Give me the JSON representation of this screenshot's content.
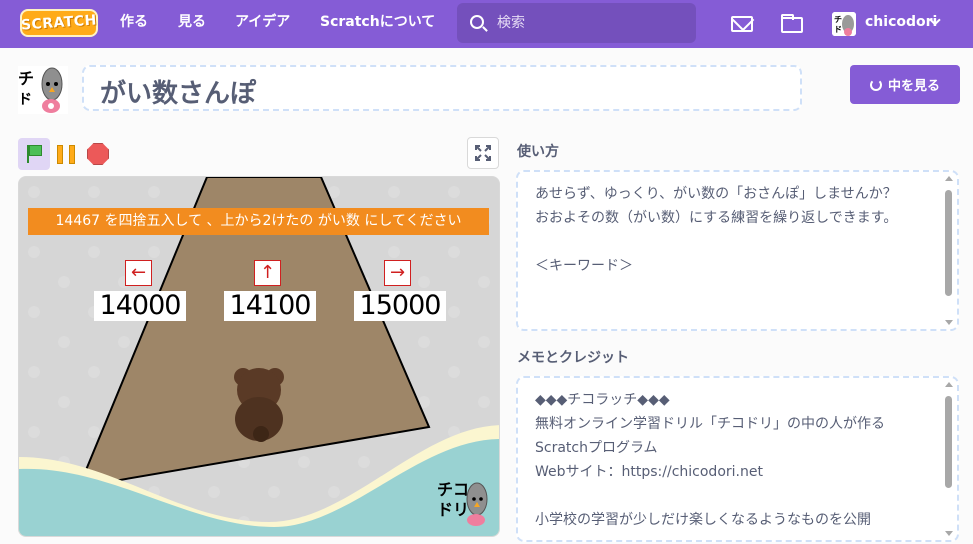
{
  "nav": {
    "logo": "SCRATCH",
    "links": [
      "作る",
      "見る",
      "アイデア",
      "Scratchについて"
    ],
    "search_placeholder": "検索",
    "username": "chicodori"
  },
  "project": {
    "title": "がい数さんぽ",
    "see_inside": "中を見る"
  },
  "stage": {
    "question": "14467 を四捨五入して 、上から2けたの がい数 にしてください",
    "answers": [
      "14000",
      "14100",
      "15000"
    ],
    "arrows": [
      "←",
      "↑",
      "→"
    ],
    "logo_text": [
      "チコ",
      "ドリ"
    ]
  },
  "instructions": {
    "label": "使い方",
    "text": "あせらず、ゆっくり、がい数の「おさんぽ」しませんか？\nおおよその数（がい数）にする練習を繰り返しできます。\n\n＜キーワード＞"
  },
  "notes": {
    "label": "メモとクレジット",
    "text": "◆◆◆チコラッチ◆◆◆\n無料オンライン学習ドリル「チコドリ」の中の人が作るScratchプログラム\nWebサイト：https://chicodori.net\n\n小学校の学習が少しだけ楽しくなるようなものを公開"
  },
  "colors": {
    "nav": "#855cd6",
    "question_bg": "#f28c1f",
    "road": "#9e8668",
    "ground": "#99d2d2"
  }
}
